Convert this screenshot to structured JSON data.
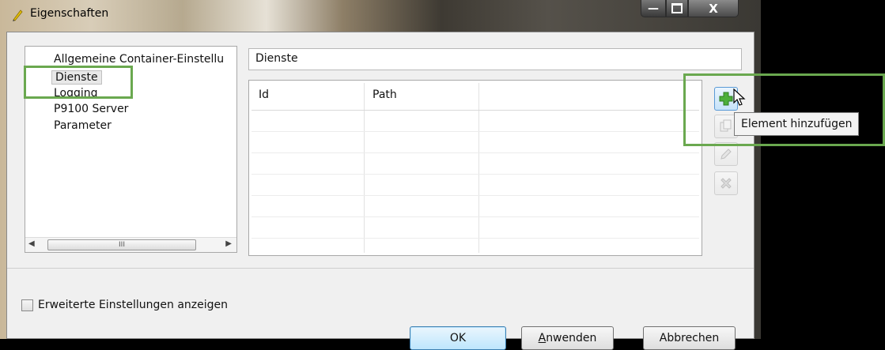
{
  "window": {
    "title": "Eigenschaften",
    "title_icon": "pen-icon",
    "caption_buttons": [
      "minimize",
      "maximize",
      "close"
    ]
  },
  "tree": {
    "items": [
      {
        "label": "Allgemeine Container-Einstellu",
        "selected": false
      },
      {
        "label": "Dienste",
        "selected": true
      },
      {
        "label": "Logging",
        "selected": false
      },
      {
        "label": "P9100 Server",
        "selected": false
      },
      {
        "label": "Parameter",
        "selected": false
      }
    ],
    "scroll_thumb": "III"
  },
  "section_title": "Dienste",
  "table": {
    "columns": [
      "Id",
      "Path",
      ""
    ],
    "rows": []
  },
  "side_buttons": {
    "add": {
      "icon": "plus-icon",
      "enabled": true
    },
    "copy": {
      "icon": "copy-icon",
      "enabled": false
    },
    "edit": {
      "icon": "pencil-icon",
      "enabled": false
    },
    "delete": {
      "icon": "x-icon",
      "enabled": false
    }
  },
  "tooltip": "Element hinzufügen",
  "checkbox": {
    "label": "Erweiterte Einstellungen anzeigen",
    "checked": false
  },
  "buttons": {
    "ok": "OK",
    "apply_mnemonic": "A",
    "apply_rest": "nwenden",
    "cancel": "Abbrechen"
  },
  "colors": {
    "highlight": "#6aa84f",
    "add_icon": "#4caf3a"
  }
}
